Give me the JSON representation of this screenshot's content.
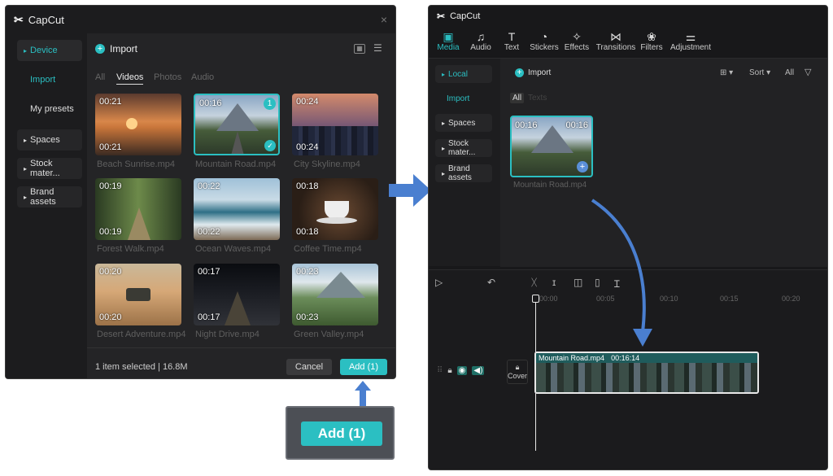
{
  "left_window": {
    "app_title": "CapCut",
    "close": "×",
    "sidebar": [
      {
        "label": "Device"
      },
      {
        "label": "Import"
      },
      {
        "label": "My presets"
      },
      {
        "label": "Spaces"
      },
      {
        "label": "Stock mater..."
      },
      {
        "label": "Brand assets"
      }
    ],
    "header_title": "Import",
    "tabs": [
      "All",
      "Videos",
      "Photos",
      "Audio"
    ],
    "items": [
      {
        "duration": "00:21",
        "name": "Beach Sunrise.mp4"
      },
      {
        "duration": "00:16",
        "name": "Mountain Road.mp4",
        "badge": "1"
      },
      {
        "duration": "00:24",
        "name": "City Skyline.mp4"
      },
      {
        "duration": "00:19",
        "name": "Forest Walk.mp4"
      },
      {
        "duration": "00:22",
        "name": "Ocean Waves.mp4"
      },
      {
        "duration": "00:18",
        "name": "Coffee Time.mp4"
      },
      {
        "duration": "00:20",
        "name": "Desert Adventure.mp4"
      },
      {
        "duration": "00:17",
        "name": "Night Drive.mp4"
      },
      {
        "duration": "00:23",
        "name": "Green Valley.mp4"
      }
    ],
    "status": "1 item selected | 16.8M",
    "cancel_label": "Cancel",
    "add_label": "Add (1)"
  },
  "callout_label": "Add (1)",
  "right_window": {
    "app_title": "CapCut",
    "toolbar": [
      {
        "label": "Media",
        "icon": "▣"
      },
      {
        "label": "Audio",
        "icon": "♫"
      },
      {
        "label": "Text",
        "icon": "T"
      },
      {
        "label": "Stickers",
        "icon": "◔"
      },
      {
        "label": "Effects",
        "icon": "✧"
      },
      {
        "label": "Transitions",
        "icon": "⋈"
      },
      {
        "label": "Filters",
        "icon": "❀"
      },
      {
        "label": "Adjustment",
        "icon": "⚌"
      }
    ],
    "sidebar": [
      {
        "label": "Local"
      },
      {
        "label": "Import"
      },
      {
        "label": "Spaces"
      },
      {
        "label": "Stock mater..."
      },
      {
        "label": "Brand assets"
      }
    ],
    "import_label": "Import",
    "sort_label": "Sort",
    "all_label": "All",
    "filter_tabs": [
      "All",
      "Texts"
    ],
    "media_item": {
      "duration_left": "00:16",
      "duration_right": "00:16",
      "name": "Mountain Road.mp4"
    },
    "ruler": [
      "00:00",
      "00:05",
      "00:10",
      "00:15",
      "00:20"
    ],
    "track_cover_label": "Cover",
    "clip_name": "Mountain Road.mp4",
    "clip_duration": "00:16:14"
  },
  "colors": {
    "accent": "#2bbfc2",
    "arrow": "#4a7fd0",
    "panel": "#1c1c1e"
  }
}
